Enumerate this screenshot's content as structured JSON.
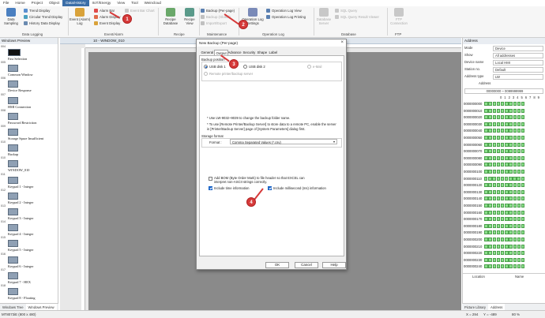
{
  "menu": {
    "file": "File",
    "home": "Home",
    "project": "Project",
    "object": "Object",
    "data_history": "Data/History",
    "iiot_energy": "IIoT/Energy",
    "view": "View",
    "tool": "Tool",
    "weincloud": "Weincloud"
  },
  "ribbon": {
    "data_sampling": "Data\nSampling",
    "trend_display": "Trend Display",
    "circular_trend": "Circular Trend Display",
    "history_data": "History Data Display",
    "data_logging": "Data Logging",
    "event_log": "Event (Alarm)\nLog",
    "alarm_bar": "Alarm Bar",
    "alarm_display": "Alarm Display",
    "event_display": "Event Display",
    "event_bar_chart": "Event Bar Chart",
    "event_alarm": "Event/Alarm",
    "recipe_database": "Recipe\nDatabase",
    "recipe_view": "Recipe\nView",
    "recipe": "Recipe",
    "backup_per_page": "Backup (Per-page)",
    "backup_global": "Backup (Global)",
    "import_export": "Import/Export",
    "maintenance": "Maintenance",
    "op_log_settings": "Operation Log\nSettings",
    "op_log_view": "Operation Log View",
    "op_log_printing": "Operation Log Printing",
    "operation_log": "Operation Log",
    "database_server": "Database\nServer",
    "sql_query": "SQL Query",
    "sql_query_result": "SQL Query Result Viewer",
    "database": "Database",
    "ftp_connection": "FTP\nConnection",
    "ftp": "FTP"
  },
  "windows_preview": {
    "title": "Windows Preview",
    "items": [
      {
        "num": "004",
        "label": "Fast Selection"
      },
      {
        "num": "005",
        "label": "Common Window"
      },
      {
        "num": "006",
        "label": "Device Response"
      },
      {
        "num": "007",
        "label": "HMI Connection"
      },
      {
        "num": "008",
        "label": "Password Restriction"
      },
      {
        "num": "009",
        "label": "Storage Space Insufficient"
      },
      {
        "num": "010",
        "label": "Backup"
      },
      {
        "num": "010",
        "label": "WINDOW_010"
      },
      {
        "num": "011",
        "label": "Keypad 1 - Integer"
      },
      {
        "num": "012",
        "label": "Keypad 2 - Integer"
      },
      {
        "num": "013",
        "label": "Keypad 3 - Integer"
      },
      {
        "num": "014",
        "label": "Keypad 4 - Integer"
      },
      {
        "num": "015",
        "label": "Keypad 5 - Integer"
      },
      {
        "num": "016",
        "label": "Keypad 6 - Integer"
      },
      {
        "num": "017",
        "label": "Keypad 7 - HEX"
      },
      {
        "num": "018",
        "label": "Keypad 8 - Floating"
      }
    ],
    "tab_tree": "Windows Tree",
    "tab_preview": "Windows Preview"
  },
  "doc_tab": "10 - WINDOW_010",
  "address_panel": {
    "title": "Address",
    "mode_label": "Mode",
    "mode_value": "Device",
    "show_label": "Show",
    "show_value": "All addresses",
    "device_label": "Device name",
    "device_value": "Local HMI",
    "station_label": "Station no.",
    "station_value": "Default",
    "type_label": "Address type",
    "type_value": "LW",
    "address_label": "Address",
    "address_value": "00000000 ~ 0099999999",
    "bit_header": "0 1 2 3 4 5 6 7 8 9",
    "rows": [
      "0000000000",
      "0000000010",
      "0000000020",
      "0000000030",
      "0000000040",
      "0000000050",
      "0000000060",
      "0000000070",
      "0000000080",
      "0000000090",
      "0000000100",
      "0000000110",
      "0000000120",
      "0000000130",
      "0000000140",
      "0000000150",
      "0000000160",
      "0000000170",
      "0000000180",
      "0000000190",
      "0000000200",
      "0000000210",
      "0000000220",
      "0000000230",
      "0000000240"
    ],
    "col_location": "Location",
    "col_name": "Name",
    "tab_picture": "Picture Library",
    "tab_address": "Address"
  },
  "status": {
    "model": "MT8073iE (800 x 480)",
    "x": "X = 294",
    "y": "Y = -489",
    "zoom": "80 %"
  },
  "dialog": {
    "title": "New Backup (Per-page)",
    "close": "×",
    "tabs": [
      "General",
      "Output",
      "Advance",
      "Security",
      "Shape",
      "Label"
    ],
    "backup_position": "Backup position",
    "usb1": "USB disk 1",
    "usb2": "USB disk 2",
    "email": "e-Mail",
    "remote": "Remote printer/backup server",
    "note1": "* Use LW-9032~9039 to change the backup folder name.",
    "note2": "* To use [Remote Printer/Backup Server] to store data to a remote PC, enable the server in [Printer/Backup Server] page of [System Parameters] dialog first.",
    "storage_format": "Storage format",
    "format_label": "Format :",
    "format_value": "Comma Separated Values (*.csv)",
    "bom": "Add BOM (Byte Order Mark) to file header so that EXCEL can interpret non-ASCII strings correctly.",
    "include_time": "Include time information",
    "include_ms": "Include millisecond (ms) information",
    "ok": "OK",
    "cancel": "Cancel",
    "help": "Help"
  },
  "callouts": [
    "1",
    "2",
    "3",
    "4"
  ],
  "colors": {
    "accent": "#3b6ea8",
    "callout": "#d63a3a",
    "bit_on": "#8be08b"
  }
}
